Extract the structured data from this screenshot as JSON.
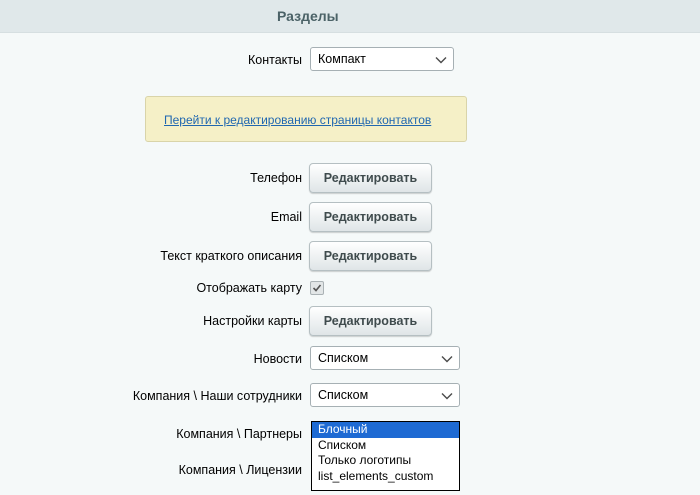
{
  "header": {
    "title": "Разделы"
  },
  "contacts": {
    "label": "Контакты",
    "value": "Компакт"
  },
  "info": {
    "link": "Перейти к редактированию страницы контактов"
  },
  "rows": [
    {
      "label": "Телефон",
      "button": "Редактировать"
    },
    {
      "label": "Email",
      "button": "Редактировать"
    },
    {
      "label": "Текст краткого описания",
      "button": "Редактировать"
    }
  ],
  "map_toggle": {
    "label": "Отображать карту",
    "checked": true
  },
  "map_settings": {
    "label": "Настройки карты",
    "button": "Редактировать"
  },
  "news": {
    "label": "Новости",
    "value": "Списком"
  },
  "staff": {
    "label": "Компания \\ Наши сотрудники",
    "value": "Списком"
  },
  "partners": {
    "label": "Компания \\ Партнеры",
    "options": [
      "Блочный",
      "Списком",
      "Только логотипы",
      "list_elements_custom"
    ],
    "selected_index": 0
  },
  "licenses": {
    "label": "Компания \\ Лицензии"
  }
}
